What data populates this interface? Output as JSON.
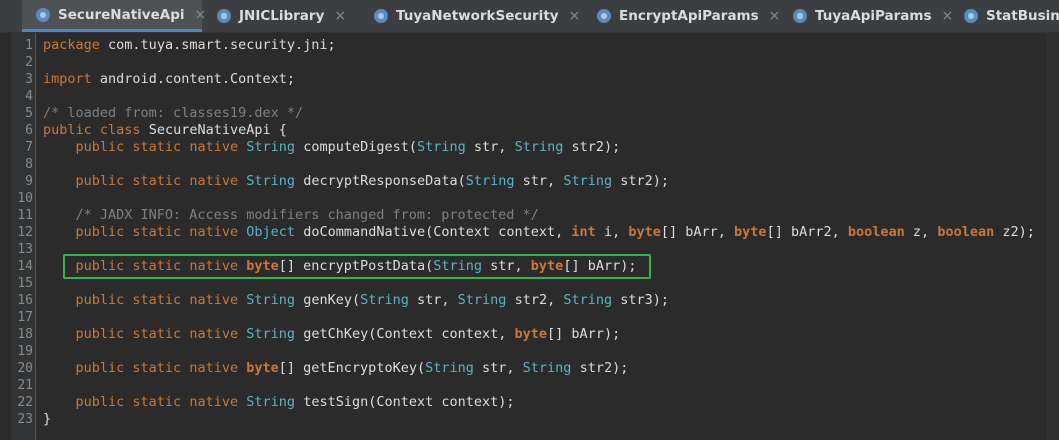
{
  "tabs": [
    {
      "label": "SecureNativeApi",
      "icon": "class-icon",
      "close": "×",
      "active": true
    },
    {
      "label": "JNICLibrary",
      "icon": "class-icon",
      "close": "×",
      "active": false
    },
    {
      "label": "TuyaNetworkSecurity",
      "icon": "class-icon",
      "close": "×",
      "active": false
    },
    {
      "label": "EncryptApiParams",
      "icon": "class-icon",
      "close": "×",
      "active": false
    },
    {
      "label": "TuyaApiParams",
      "icon": "class-icon",
      "close": "×",
      "active": false
    },
    {
      "label": "StatBusine",
      "icon": "class-icon",
      "close": "",
      "active": false
    }
  ],
  "lines": [
    {
      "n": "1",
      "t": [
        [
          "kw",
          "package"
        ],
        [
          "",
          "com.tuya.smart.security.jni;"
        ]
      ]
    },
    {
      "n": "2",
      "t": []
    },
    {
      "n": "3",
      "t": [
        [
          "kw",
          "import"
        ],
        [
          "",
          "android.content.Context;"
        ]
      ]
    },
    {
      "n": "4",
      "t": []
    },
    {
      "n": "5",
      "t": [
        [
          "cm",
          "/* loaded from: classes19.dex */"
        ]
      ]
    },
    {
      "n": "6",
      "t": [
        [
          "kw",
          "public"
        ],
        [
          "kw",
          "class"
        ],
        [
          "",
          "SecureNativeApi {"
        ]
      ]
    },
    {
      "n": "7",
      "t": [
        [
          "kw",
          "    public"
        ],
        [
          "kw",
          "static"
        ],
        [
          "kw",
          "native"
        ],
        [
          "ty",
          "String"
        ],
        [
          "",
          "computeDigest("
        ],
        [
          "ty",
          "String"
        ],
        [
          "",
          "str,"
        ],
        [
          "ty",
          "String"
        ],
        [
          "",
          "str2);"
        ]
      ]
    },
    {
      "n": "8",
      "t": []
    },
    {
      "n": "9",
      "t": [
        [
          "kw",
          "    public"
        ],
        [
          "kw",
          "static"
        ],
        [
          "kw",
          "native"
        ],
        [
          "ty",
          "String"
        ],
        [
          "",
          "decryptResponseData("
        ],
        [
          "ty",
          "String"
        ],
        [
          "",
          "str,"
        ],
        [
          "ty",
          "String"
        ],
        [
          "",
          "str2);"
        ]
      ]
    },
    {
      "n": "10",
      "t": []
    },
    {
      "n": "11",
      "t": [
        [
          "cm",
          "    /* JADX INFO: Access modifiers changed from: protected */"
        ]
      ]
    },
    {
      "n": "12",
      "t": [
        [
          "kw",
          "    public"
        ],
        [
          "kw",
          "static"
        ],
        [
          "kw",
          "native"
        ],
        [
          "ty",
          "Object"
        ],
        [
          "",
          "doCommandNative(Context context,"
        ],
        [
          "pk",
          "int"
        ],
        [
          "",
          "i,"
        ],
        [
          "pk",
          "byte"
        ],
        [
          "",
          "[] bArr,"
        ],
        [
          "pk",
          "byte"
        ],
        [
          "",
          "[] bArr2,"
        ],
        [
          "pk",
          "boolean"
        ],
        [
          "",
          "z,"
        ],
        [
          "pk",
          "boolean"
        ],
        [
          "",
          "z2);"
        ]
      ]
    },
    {
      "n": "13",
      "t": []
    },
    {
      "n": "14",
      "t": [
        [
          "kw",
          "    public"
        ],
        [
          "kw",
          "static"
        ],
        [
          "kw",
          "native"
        ],
        [
          "pk",
          "byte"
        ],
        [
          "",
          "[] encryptPostData("
        ],
        [
          "ty",
          "String"
        ],
        [
          "",
          "str,"
        ],
        [
          "pk",
          "byte"
        ],
        [
          "",
          "[] bArr);"
        ]
      ]
    },
    {
      "n": "15",
      "t": []
    },
    {
      "n": "16",
      "t": [
        [
          "kw",
          "    public"
        ],
        [
          "kw",
          "static"
        ],
        [
          "kw",
          "native"
        ],
        [
          "ty",
          "String"
        ],
        [
          "",
          "genKey("
        ],
        [
          "ty",
          "String"
        ],
        [
          "",
          "str,"
        ],
        [
          "ty",
          "String"
        ],
        [
          "",
          "str2,"
        ],
        [
          "ty",
          "String"
        ],
        [
          "",
          "str3);"
        ]
      ]
    },
    {
      "n": "17",
      "t": []
    },
    {
      "n": "18",
      "t": [
        [
          "kw",
          "    public"
        ],
        [
          "kw",
          "static"
        ],
        [
          "kw",
          "native"
        ],
        [
          "ty",
          "String"
        ],
        [
          "",
          "getChKey(Context context,"
        ],
        [
          "pk",
          "byte"
        ],
        [
          "",
          "[] bArr);"
        ]
      ]
    },
    {
      "n": "19",
      "t": []
    },
    {
      "n": "20",
      "t": [
        [
          "kw",
          "    public"
        ],
        [
          "kw",
          "static"
        ],
        [
          "kw",
          "native"
        ],
        [
          "pk",
          "byte"
        ],
        [
          "",
          "[] getEncryptoKey("
        ],
        [
          "ty",
          "String"
        ],
        [
          "",
          "str,"
        ],
        [
          "ty",
          "String"
        ],
        [
          "",
          "str2);"
        ]
      ]
    },
    {
      "n": "21",
      "t": []
    },
    {
      "n": "22",
      "t": [
        [
          "kw",
          "    public"
        ],
        [
          "kw",
          "static"
        ],
        [
          "kw",
          "native"
        ],
        [
          "ty",
          "String"
        ],
        [
          "",
          "testSign(Context context);"
        ]
      ]
    },
    {
      "n": "23",
      "t": [
        [
          "",
          "}"
        ]
      ]
    }
  ],
  "highlight": {
    "line": "14",
    "color": "#2fb84a"
  }
}
